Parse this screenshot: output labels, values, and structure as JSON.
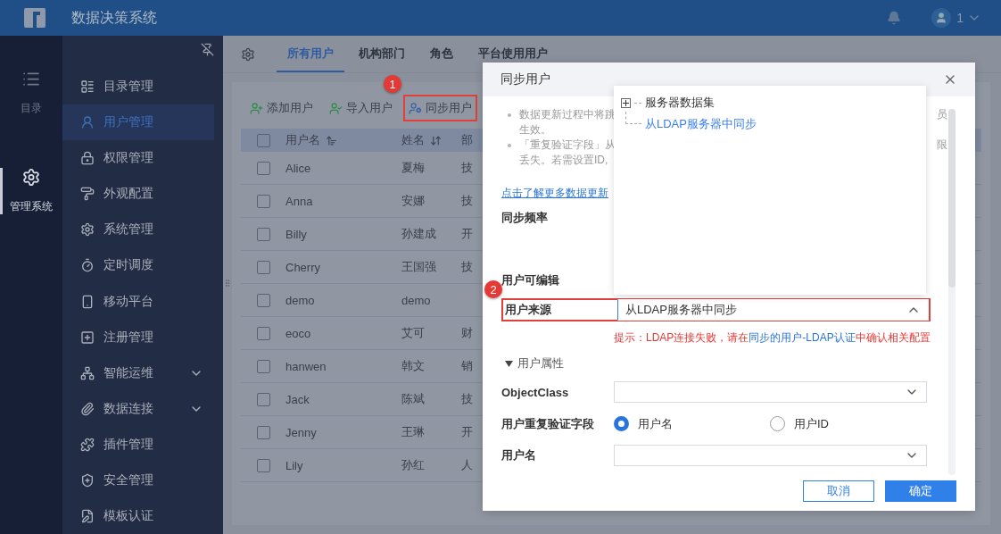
{
  "header": {
    "title": "数据决策系统",
    "user": "1"
  },
  "rail": [
    {
      "label": "目录",
      "selected": false
    },
    {
      "label": "管理系统",
      "selected": true
    }
  ],
  "sidebar": {
    "items": [
      {
        "label": "目录管理",
        "selected": false,
        "has_submenu": false
      },
      {
        "label": "用户管理",
        "selected": true,
        "has_submenu": false
      },
      {
        "label": "权限管理",
        "selected": false,
        "has_submenu": false
      },
      {
        "label": "外观配置",
        "selected": false,
        "has_submenu": false
      },
      {
        "label": "系统管理",
        "selected": false,
        "has_submenu": false
      },
      {
        "label": "定时调度",
        "selected": false,
        "has_submenu": false
      },
      {
        "label": "移动平台",
        "selected": false,
        "has_submenu": false
      },
      {
        "label": "注册管理",
        "selected": false,
        "has_submenu": false
      },
      {
        "label": "智能运维",
        "selected": false,
        "has_submenu": true
      },
      {
        "label": "数据连接",
        "selected": false,
        "has_submenu": true
      },
      {
        "label": "插件管理",
        "selected": false,
        "has_submenu": false
      },
      {
        "label": "安全管理",
        "selected": false,
        "has_submenu": false
      },
      {
        "label": "模板认证",
        "selected": false,
        "has_submenu": false
      }
    ]
  },
  "tabs": [
    {
      "label": "所有用户",
      "selected": true
    },
    {
      "label": "机构部门",
      "selected": false
    },
    {
      "label": "角色",
      "selected": false
    },
    {
      "label": "平台使用用户",
      "selected": false
    }
  ],
  "toolbar": [
    {
      "label": "添加用户",
      "highlighted": false
    },
    {
      "label": "导入用户",
      "highlighted": false
    },
    {
      "label": "同步用户",
      "highlighted": true,
      "callout": "1"
    }
  ],
  "table": {
    "select_all": false,
    "columns": [
      "用户名",
      "姓名",
      "部"
    ],
    "rows": [
      {
        "checked": false,
        "username": "Alice",
        "name": "夏梅",
        "column_3": "技"
      },
      {
        "checked": false,
        "username": "Anna",
        "name": "安娜",
        "column_3": "技"
      },
      {
        "checked": false,
        "username": "Billy",
        "name": "孙建成",
        "column_3": "开"
      },
      {
        "checked": false,
        "username": "Cherry",
        "name": "王国强",
        "column_3": "技"
      },
      {
        "checked": false,
        "username": "demo",
        "name": "demo"
      },
      {
        "checked": false,
        "username": "eoco",
        "name": "艾可",
        "column_3": "财"
      },
      {
        "checked": false,
        "username": "hanwen",
        "name": "韩文",
        "column_3": "销"
      },
      {
        "checked": false,
        "username": "Jack",
        "name": "陈斌",
        "column_3": "技"
      },
      {
        "checked": false,
        "username": "Jenny",
        "name": "王琳",
        "column_3": "开"
      },
      {
        "checked": false,
        "username": "Lily",
        "name": "孙红",
        "column_3": "人"
      }
    ]
  },
  "dialog": {
    "title": "同步用户",
    "notes": [
      {
        "lines": [
          {
            "left": "数据更新过程中将跳",
            "right": "员"
          },
          {
            "left": "生效。"
          }
        ]
      },
      {
        "lines": [
          {
            "left": "「重复验证字段」从",
            "right": "限"
          },
          {
            "left": "丢失。若需设置ID,"
          }
        ]
      }
    ],
    "link": "点击了解更多数据更新",
    "fields": [
      {
        "kind": "label",
        "label": "同步频率"
      },
      {
        "kind": "label",
        "label": "用户可编辑"
      },
      {
        "kind": "select",
        "label": "用户来源",
        "value": "从LDAP服务器中同步",
        "expanded": true,
        "callout": "2"
      },
      {
        "kind": "hint",
        "parts": [
          {
            "kind": "plain",
            "text": "提示：LDAP连接失败，请在"
          },
          {
            "kind": "link",
            "text": "同步的用户-LDAP认证"
          },
          {
            "kind": "plain",
            "text": "中确认相关配置"
          }
        ]
      },
      {
        "kind": "section",
        "label": "用户属性",
        "expanded": true
      },
      {
        "kind": "select",
        "label": "ObjectClass",
        "expanded": false
      },
      {
        "kind": "radio",
        "label": "用户重复验证字段",
        "options": [
          {
            "label": "用户名",
            "selected": true
          },
          {
            "label": "用户ID",
            "selected": false
          }
        ]
      },
      {
        "kind": "select",
        "label": "用户名",
        "expanded": false
      }
    ],
    "dropdown": [
      {
        "kind": "folder",
        "label": "服务器数据集",
        "expanded": false,
        "selected": false
      },
      {
        "kind": "leaf",
        "label": "从LDAP服务器中同步",
        "selected": true
      }
    ],
    "buttons": [
      {
        "label": "取消",
        "kind": "secondary"
      },
      {
        "label": "确定",
        "kind": "primary"
      }
    ]
  }
}
